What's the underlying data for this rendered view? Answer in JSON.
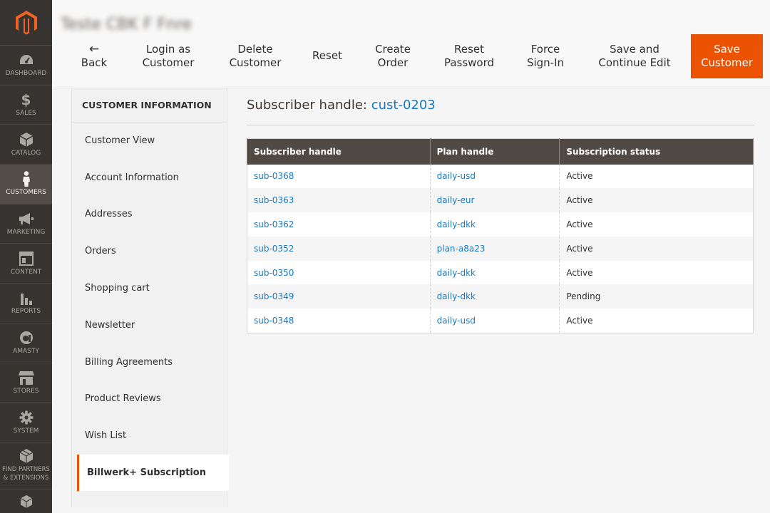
{
  "page": {
    "title": "Teste CBK F Fnre"
  },
  "menu": {
    "items": [
      {
        "id": "dashboard",
        "label": "DASHBOARD",
        "icon": "speedometer-icon"
      },
      {
        "id": "sales",
        "label": "SALES",
        "icon": "dollar-icon"
      },
      {
        "id": "catalog",
        "label": "CATALOG",
        "icon": "box-icon"
      },
      {
        "id": "customers",
        "label": "CUSTOMERS",
        "icon": "person-icon",
        "active": true
      },
      {
        "id": "marketing",
        "label": "MARKETING",
        "icon": "megaphone-icon"
      },
      {
        "id": "content",
        "label": "CONTENT",
        "icon": "layout-icon"
      },
      {
        "id": "reports",
        "label": "REPORTS",
        "icon": "bar-chart-icon"
      },
      {
        "id": "amasty",
        "label": "AMASTY",
        "icon": "amasty-icon"
      },
      {
        "id": "stores",
        "label": "STORES",
        "icon": "storefront-icon"
      },
      {
        "id": "system",
        "label": "SYSTEM",
        "icon": "gear-icon"
      },
      {
        "id": "partners",
        "label_line1": "FIND PARTNERS",
        "label_line2": "& EXTENSIONS",
        "icon": "cubes-icon"
      }
    ]
  },
  "actions": {
    "back": "Back",
    "login_as_line1": "Login as",
    "login_as_line2": "Customer",
    "delete_line1": "Delete",
    "delete_line2": "Customer",
    "reset": "Reset",
    "create_order_line1": "Create",
    "create_order_line2": "Order",
    "reset_password_line1": "Reset",
    "reset_password_line2": "Password",
    "force_signin_line1": "Force",
    "force_signin_line2": "Sign-In",
    "save_continue_line1": "Save and",
    "save_continue_line2": "Continue Edit",
    "save_customer_line1": "Save",
    "save_customer_line2": "Customer",
    "accent_color": "#eb5202"
  },
  "tabs": {
    "title": "CUSTOMER INFORMATION",
    "items": [
      "Customer View",
      "Account Information",
      "Addresses",
      "Orders",
      "Shopping cart",
      "Newsletter",
      "Billing Agreements",
      "Product Reviews",
      "Wish List",
      "Billwerk+ Subscription"
    ],
    "active": "Billwerk+ Subscription"
  },
  "main": {
    "heading_label": "Subscriber handle:",
    "heading_value": "cust-0203"
  },
  "grid": {
    "headers": [
      "Subscriber handle",
      "Plan handle",
      "Subscription status"
    ],
    "rows": [
      [
        "sub-0368",
        "daily-usd",
        "Active"
      ],
      [
        "sub-0363",
        "daily-eur",
        "Active"
      ],
      [
        "sub-0362",
        "daily-dkk",
        "Active"
      ],
      [
        "sub-0352",
        "plan-a8a23",
        "Active"
      ],
      [
        "sub-0350",
        "daily-dkk",
        "Active"
      ],
      [
        "sub-0349",
        "daily-dkk",
        "Pending"
      ],
      [
        "sub-0348",
        "daily-usd",
        "Active"
      ]
    ]
  }
}
